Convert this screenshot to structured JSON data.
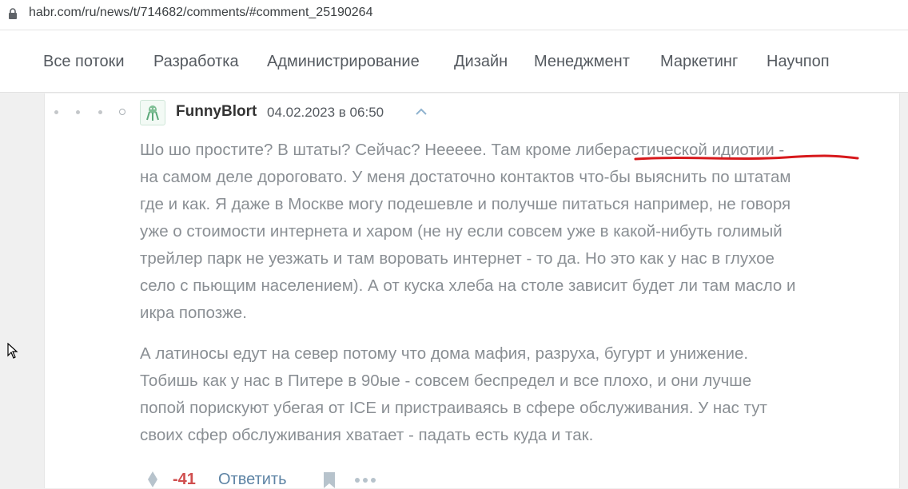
{
  "browser": {
    "url": "habr.com/ru/news/t/714682/comments/#comment_25190264",
    "icons": [
      "lock-icon"
    ]
  },
  "nav": {
    "items": [
      {
        "label": "Все потоки"
      },
      {
        "label": "Разработка"
      },
      {
        "label": "Администрирование"
      },
      {
        "label": "Дизайн"
      },
      {
        "label": "Менеджмент"
      },
      {
        "label": "Маркетинг"
      },
      {
        "label": "Научпоп"
      }
    ]
  },
  "comment": {
    "username": "FunnyBlort",
    "timestamp": "04.02.2023 в 06:50",
    "paragraph1_lines": [
      "Шо шо простите? В штаты? Сейчас? Нееееe. Там кроме либерастической идиотии -",
      "на самом деле дороговато. У меня достаточно контактов что-бы выяснить по штатам",
      "где и как. Я даже в Москве могу подешевле и получше питаться например, не говоря",
      "уже о стоимости интернета и харом (не ну если совсем уже в какой-нибуть голимый",
      "трейлер парк не уезжать и там воровать интернет - то да. Но это как у нас в глухое",
      "село с пьющим населением). А от куска хлеба на столе зависит будет ли там масло и",
      "икра попозже."
    ],
    "paragraph2_lines": [
      "А латиносы едут на север потому что дома мафия, разруха, бугурт и унижение.",
      "Тобишь как у нас в Питере в 90ые - совсем беспредел и все плохо, и они лучше",
      "попой порискуют убегая от ICE и пристраиваясь в сфере обслуживания. У нас тут",
      "своих сфер обслуживания хватает - падать есть куда и так."
    ],
    "score": "-41",
    "reply_label": "Ответить",
    "underline_color": "#d7191c"
  },
  "colors": {
    "text_muted": "#8a8f94",
    "score_negative": "#d04e4e",
    "link": "#5e84a5"
  }
}
